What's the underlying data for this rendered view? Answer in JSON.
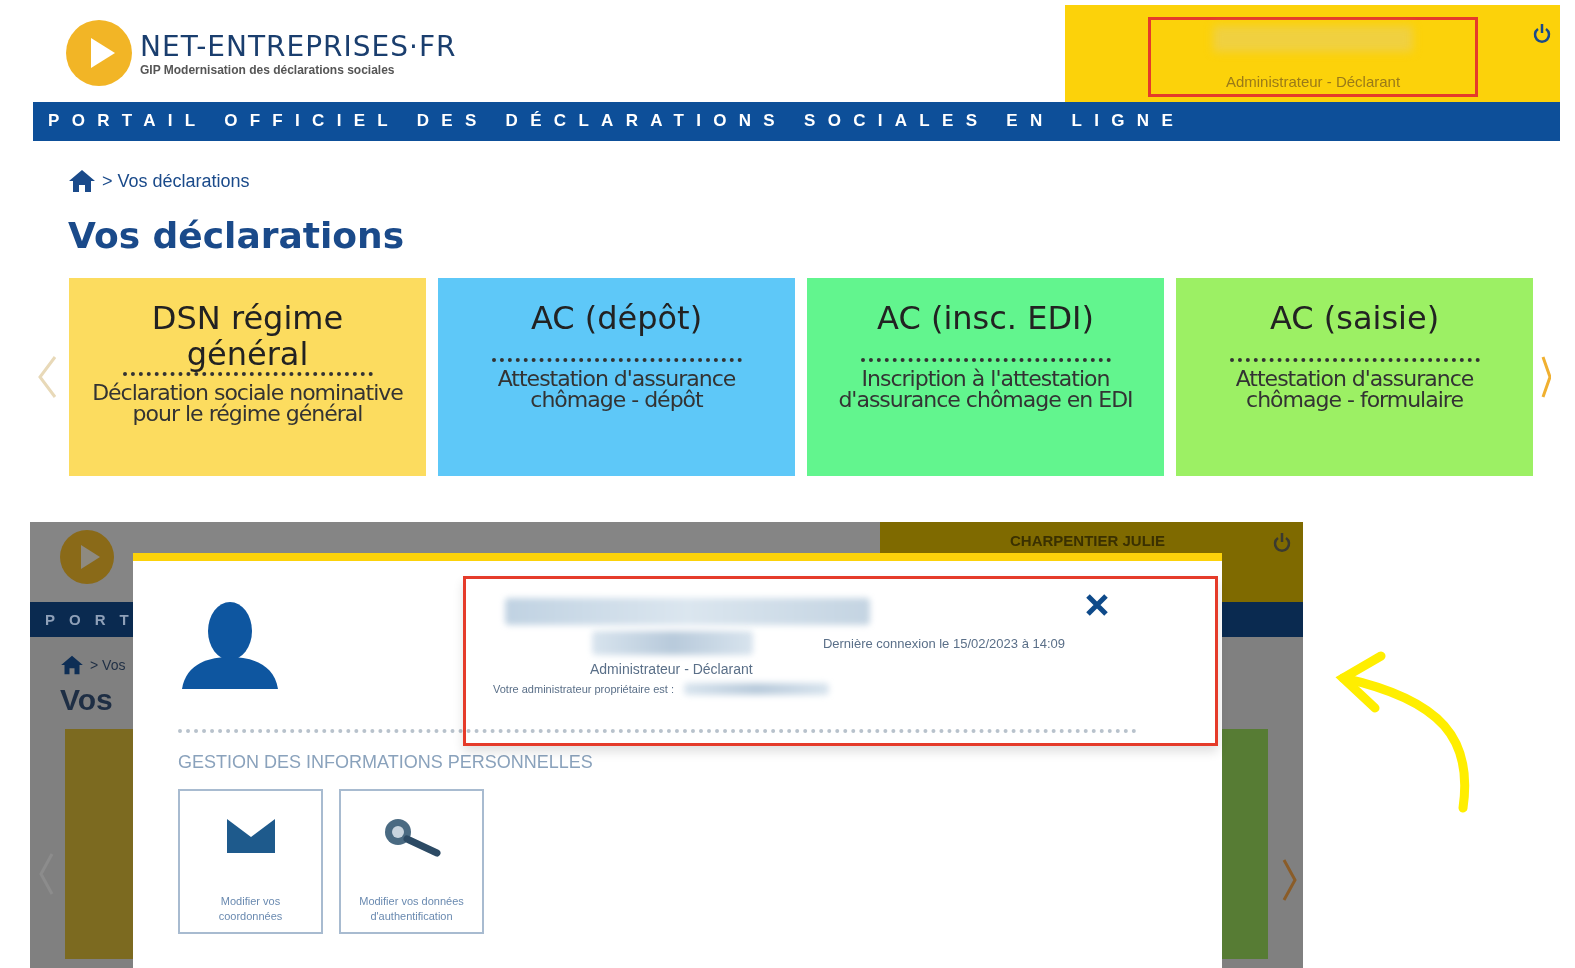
{
  "top_screenshot": {
    "logo": {
      "name": "NET-ENTREPRISES·FR",
      "tagline": "GIP Modernisation des déclarations sociales"
    },
    "user_panel": {
      "role": "Administrateur - Déclarant"
    },
    "banner": "PORTAIL OFFICIEL DES DÉCLARATIONS SOCIALES EN LIGNE",
    "breadcrumb": "> Vos déclarations",
    "title": "Vos déclarations",
    "cards": [
      {
        "title": "DSN régime général",
        "description": "Déclaration sociale nominative pour le régime général",
        "color": "#fcdc5f"
      },
      {
        "title": "AC (dépôt)",
        "description": "Attestation d'assurance chômage - dépôt",
        "color": "#5ec8f8"
      },
      {
        "title": "AC (insc. EDI)",
        "description": "Inscription à l'attestation d'assurance chômage en EDI",
        "color": "#62f58e"
      },
      {
        "title": "AC (saisie)",
        "description": "Attestation d'assurance chômage - formulaire",
        "color": "#9cf064"
      }
    ]
  },
  "bottom_screenshot": {
    "background": {
      "user_name": "CHARPENTIER JULIE",
      "banner": "PORT",
      "breadcrumb": "> Vos",
      "title": "Vos"
    },
    "modal": {
      "last_login": "Dernière connexion le 15/02/2023 à 14:09",
      "role": "Administrateur - Déclarant",
      "owner_label": "Votre administrateur propriétaire est :",
      "section_title": "GESTION DES INFORMATIONS PERSONNELLES",
      "tiles": [
        {
          "kind": "envelope",
          "label": "Modifier vos coordonnées"
        },
        {
          "kind": "key",
          "label": "Modifier vos données d'authentification"
        }
      ]
    }
  }
}
